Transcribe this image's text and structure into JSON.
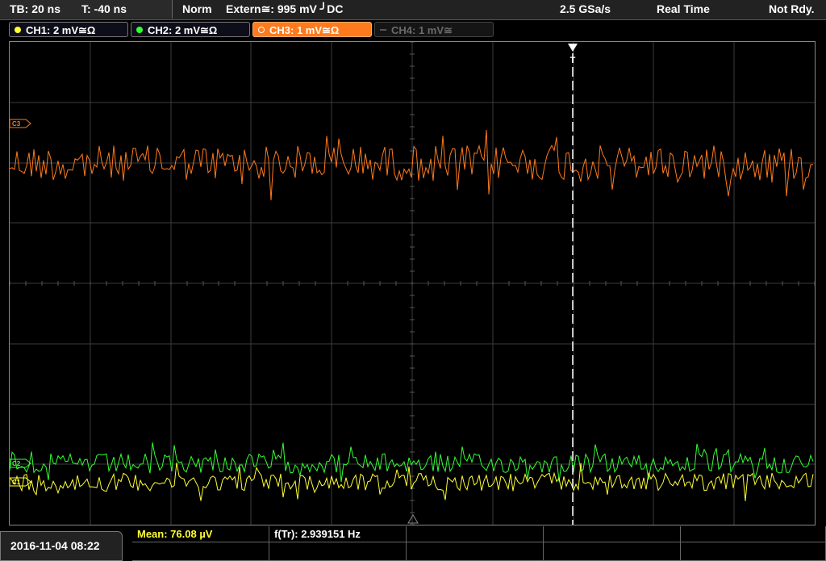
{
  "header": {
    "timebase": "TB: 20 ns",
    "trigger_time": "T: -40 ns",
    "mode": "Norm",
    "trigger_source": "Extern≅: 995 mV ╯DC",
    "sample_rate": "2.5 GSa/s",
    "acq_mode": "Real Time",
    "status": "Not Rdy."
  },
  "channels": [
    {
      "label": "CH1: 2 mV≅Ω",
      "color": "#ffff33",
      "state": "on"
    },
    {
      "label": "CH2: 2 mV≅Ω",
      "color": "#33ff33",
      "state": "on"
    },
    {
      "label": "CH3: 1 mV≅Ω",
      "color": "#ff7a1c",
      "state": "selected"
    },
    {
      "label": "CH4: 1 mV≅",
      "color": "#666666",
      "state": "off"
    }
  ],
  "markers": {
    "ch3": "C3",
    "ch2": "C2",
    "ch1": "C1",
    "trigger": "T"
  },
  "measurements": {
    "mean": "Mean: 76.08 µV",
    "freq": "f(Tr): 2.939151 Hz"
  },
  "datetime": "2016-11-04 08:22",
  "colors": {
    "ch1": "#ffff33",
    "ch2": "#33ff33",
    "ch3": "#ff7a1c",
    "grid": "#555555"
  }
}
